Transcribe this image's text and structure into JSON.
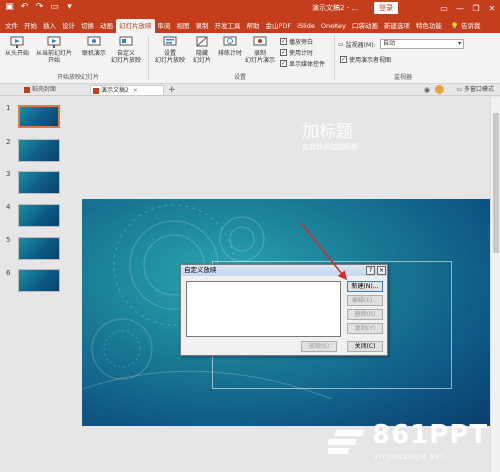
{
  "window": {
    "title": "演示文稿2 - ...",
    "login": "登录",
    "controls": [
      "minimize-icon",
      "restore-icon",
      "close-icon"
    ],
    "accent": "#c43e1c"
  },
  "tabs": [
    {
      "label": "文件"
    },
    {
      "label": "开始"
    },
    {
      "label": "插入"
    },
    {
      "label": "设计"
    },
    {
      "label": "切换"
    },
    {
      "label": "动画"
    },
    {
      "label": "幻灯片放映"
    },
    {
      "label": "审阅"
    },
    {
      "label": "视图"
    },
    {
      "label": "录制"
    },
    {
      "label": "开发工具"
    },
    {
      "label": "帮助"
    },
    {
      "label": "金山PDF"
    },
    {
      "label": "iSlide"
    },
    {
      "label": "OneKey"
    },
    {
      "label": "口袋动画"
    },
    {
      "label": "新建选项"
    },
    {
      "label": "特色功能"
    }
  ],
  "active_tab": "幻灯片放映",
  "tell_me": "告诉我",
  "ribbon": {
    "from_start": "从头开始",
    "from_current_line1": "从当前幻灯片",
    "from_current_line2": "开始",
    "online_line1": "联机演示",
    "custom_line1": "自定义",
    "custom_line2": "幻灯片放映",
    "group1": "开始放映幻灯片",
    "setup_line1": "设置",
    "setup_line2": "幻灯片放映",
    "hide_line1": "隐藏",
    "hide_line2": "幻灯片",
    "rehearse": "排练计时",
    "record_line1": "录制",
    "record_line2": "幻灯片演示",
    "chk_narration": "播放旁白",
    "chk_timing": "使用计时",
    "chk_media": "显示媒体控件",
    "group2": "设置",
    "monitor_label": "监视器(M):",
    "monitor_value": "自动",
    "presenter_view": "使用演示者视图",
    "group3": "监视器"
  },
  "doc_tabs": [
    {
      "label": "稻壳封面"
    },
    {
      "label": "演示文稿2"
    }
  ],
  "multi_window": "多窗口模式",
  "thumbnails": [
    "1",
    "2",
    "3",
    "4",
    "5",
    "6"
  ],
  "slide": {
    "title": "加标题",
    "subtitle": "击此处添加副标题"
  },
  "dialog": {
    "title": "自定义放映",
    "help": "?",
    "close": "×",
    "btn_new": "新建(N)...",
    "btn_edit": "编辑(E)...",
    "btn_delete": "删除(R)",
    "btn_copy": "复制(Y)",
    "btn_show": "放映(S)",
    "btn_close": "关闭(C)"
  },
  "watermark": {
    "brand": "861PPT",
    "url": "XITONGZHIJIA.NET"
  }
}
